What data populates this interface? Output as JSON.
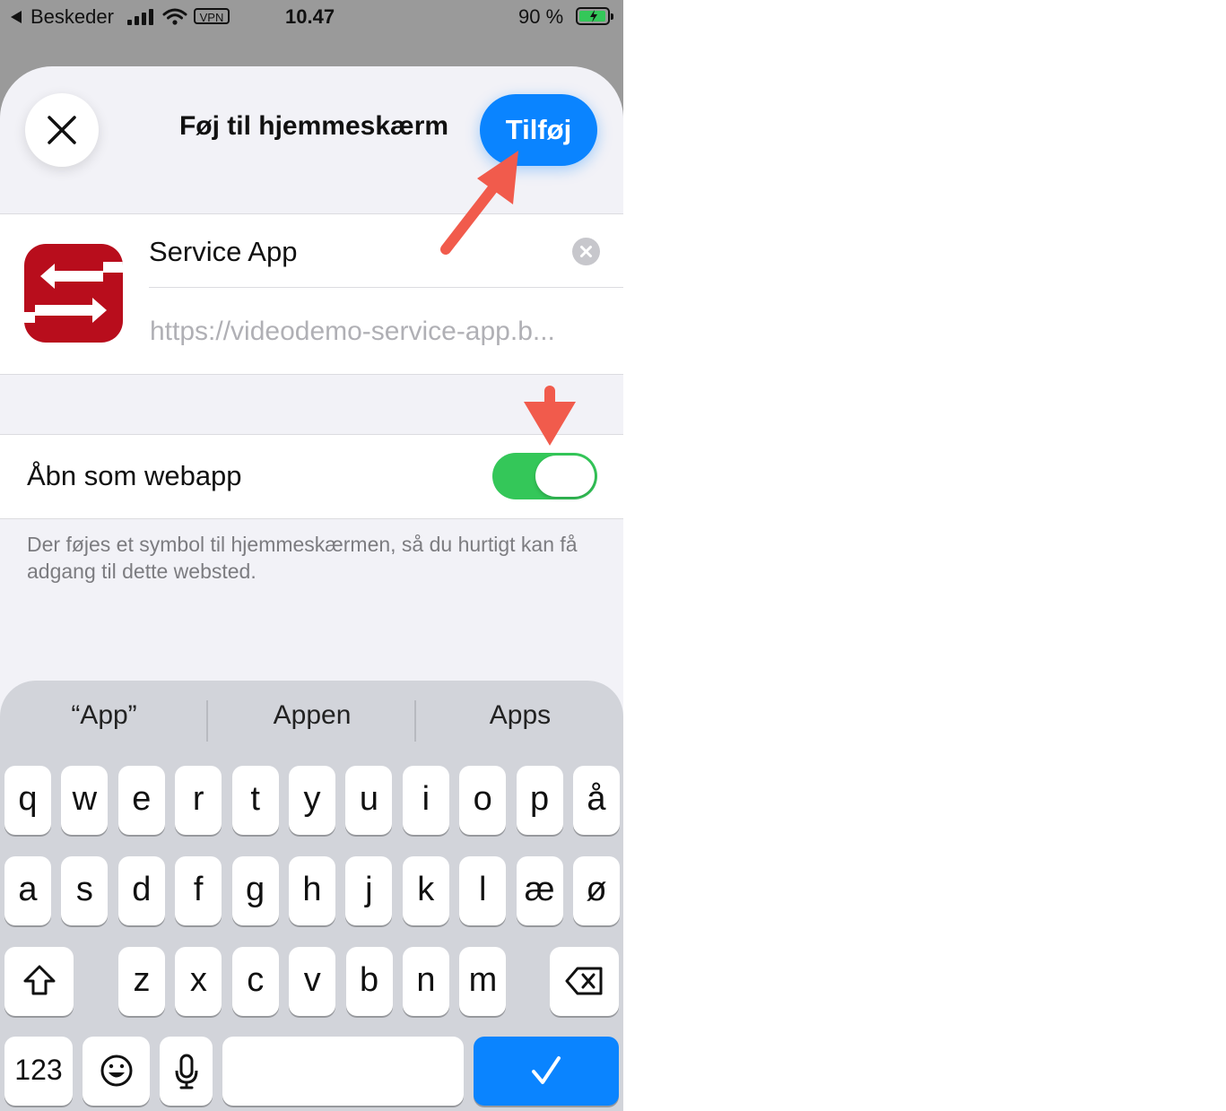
{
  "status_bar": {
    "back_app": "Beskeder",
    "vpn": "VPN",
    "time": "10.47",
    "battery": "90 %"
  },
  "header": {
    "title": "Føj til hjemmeskærm",
    "add_label": "Tilføj"
  },
  "app_card": {
    "name_value": "Service App",
    "url": "https://videodemo-service-app.b..."
  },
  "toggle": {
    "label": "Åbn som webapp",
    "on": true
  },
  "footer_note": "Der føjes et symbol til hjemmeskærmen, så du hurtigt kan få adgang til dette websted.",
  "keyboard": {
    "suggestions": [
      "“App”",
      "Appen",
      "Apps"
    ],
    "row1": [
      "q",
      "w",
      "e",
      "r",
      "t",
      "y",
      "u",
      "i",
      "o",
      "p",
      "å"
    ],
    "row2": [
      "a",
      "s",
      "d",
      "f",
      "g",
      "h",
      "j",
      "k",
      "l",
      "æ",
      "ø"
    ],
    "row3": [
      "z",
      "x",
      "c",
      "v",
      "b",
      "n",
      "m"
    ],
    "numbers_label": "123"
  },
  "colors": {
    "accent": "#0a84ff",
    "toggle_on": "#34c759",
    "annotation": "#f15b4c",
    "app_icon": "#b80d1c"
  },
  "icons": [
    "back-icon",
    "signal-icon",
    "wifi-icon",
    "battery-icon",
    "close-icon",
    "clear-icon",
    "shift-icon",
    "backspace-icon",
    "emoji-icon",
    "microphone-icon",
    "checkmark-icon"
  ]
}
